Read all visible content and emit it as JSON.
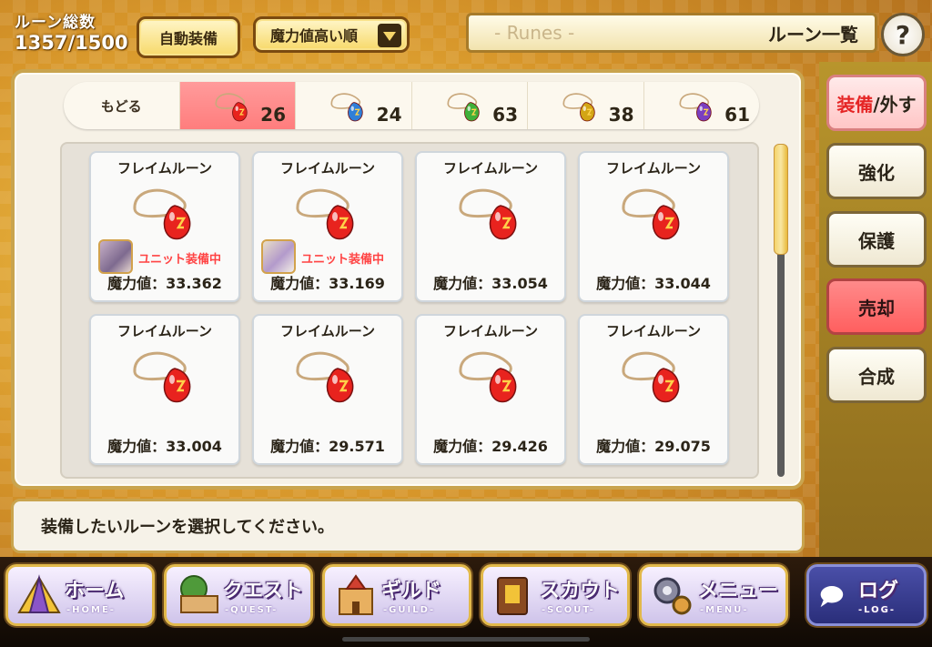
{
  "header": {
    "count_label": "ルーン総数",
    "count_value": "1357/1500",
    "auto_equip_label": "自動装備",
    "sort_label": "魔力値高い順",
    "title_en": "- Runes -",
    "title_jp": "ルーン一覧",
    "help_label": "?"
  },
  "tabs": [
    {
      "label": "もどる"
    },
    {
      "color": "#e8231e",
      "count": "26"
    },
    {
      "color": "#2f7fd8",
      "count": "24"
    },
    {
      "color": "#3fb03a",
      "count": "63"
    },
    {
      "color": "#d3a515",
      "count": "38"
    },
    {
      "color": "#7a3fc0",
      "count": "61"
    }
  ],
  "cards": [
    {
      "name": "フレイムルーン",
      "value": "魔力値：33.362",
      "equipped": "ユニット装備中"
    },
    {
      "name": "フレイムルーン",
      "value": "魔力値：33.169",
      "equipped": "ユニット装備中"
    },
    {
      "name": "フレイムルーン",
      "value": "魔力値：33.054"
    },
    {
      "name": "フレイムルーン",
      "value": "魔力値：33.044"
    },
    {
      "name": "フレイムルーン",
      "value": "魔力値：33.004"
    },
    {
      "name": "フレイムルーン",
      "value": "魔力値：29.571"
    },
    {
      "name": "フレイムルーン",
      "value": "魔力値：29.426"
    },
    {
      "name": "フレイムルーン",
      "value": "魔力値：29.075"
    }
  ],
  "message": "装備したいルーンを選択してください。",
  "side_buttons": {
    "equip_a": "装備",
    "equip_b": "/外す",
    "enhance": "強化",
    "protect": "保護",
    "sell": "売却",
    "combine": "合成"
  },
  "nav": {
    "home": {
      "label": "ホーム",
      "sub": "-HOME-"
    },
    "quest": {
      "label": "クエスト",
      "sub": "-QUEST-"
    },
    "guild": {
      "label": "ギルド",
      "sub": "-GUILD-"
    },
    "scout": {
      "label": "スカウト",
      "sub": "-SCOUT-"
    },
    "menu": {
      "label": "メニュー",
      "sub": "-MENU-"
    },
    "log": {
      "label": "ログ",
      "sub": "-LOG-"
    }
  }
}
